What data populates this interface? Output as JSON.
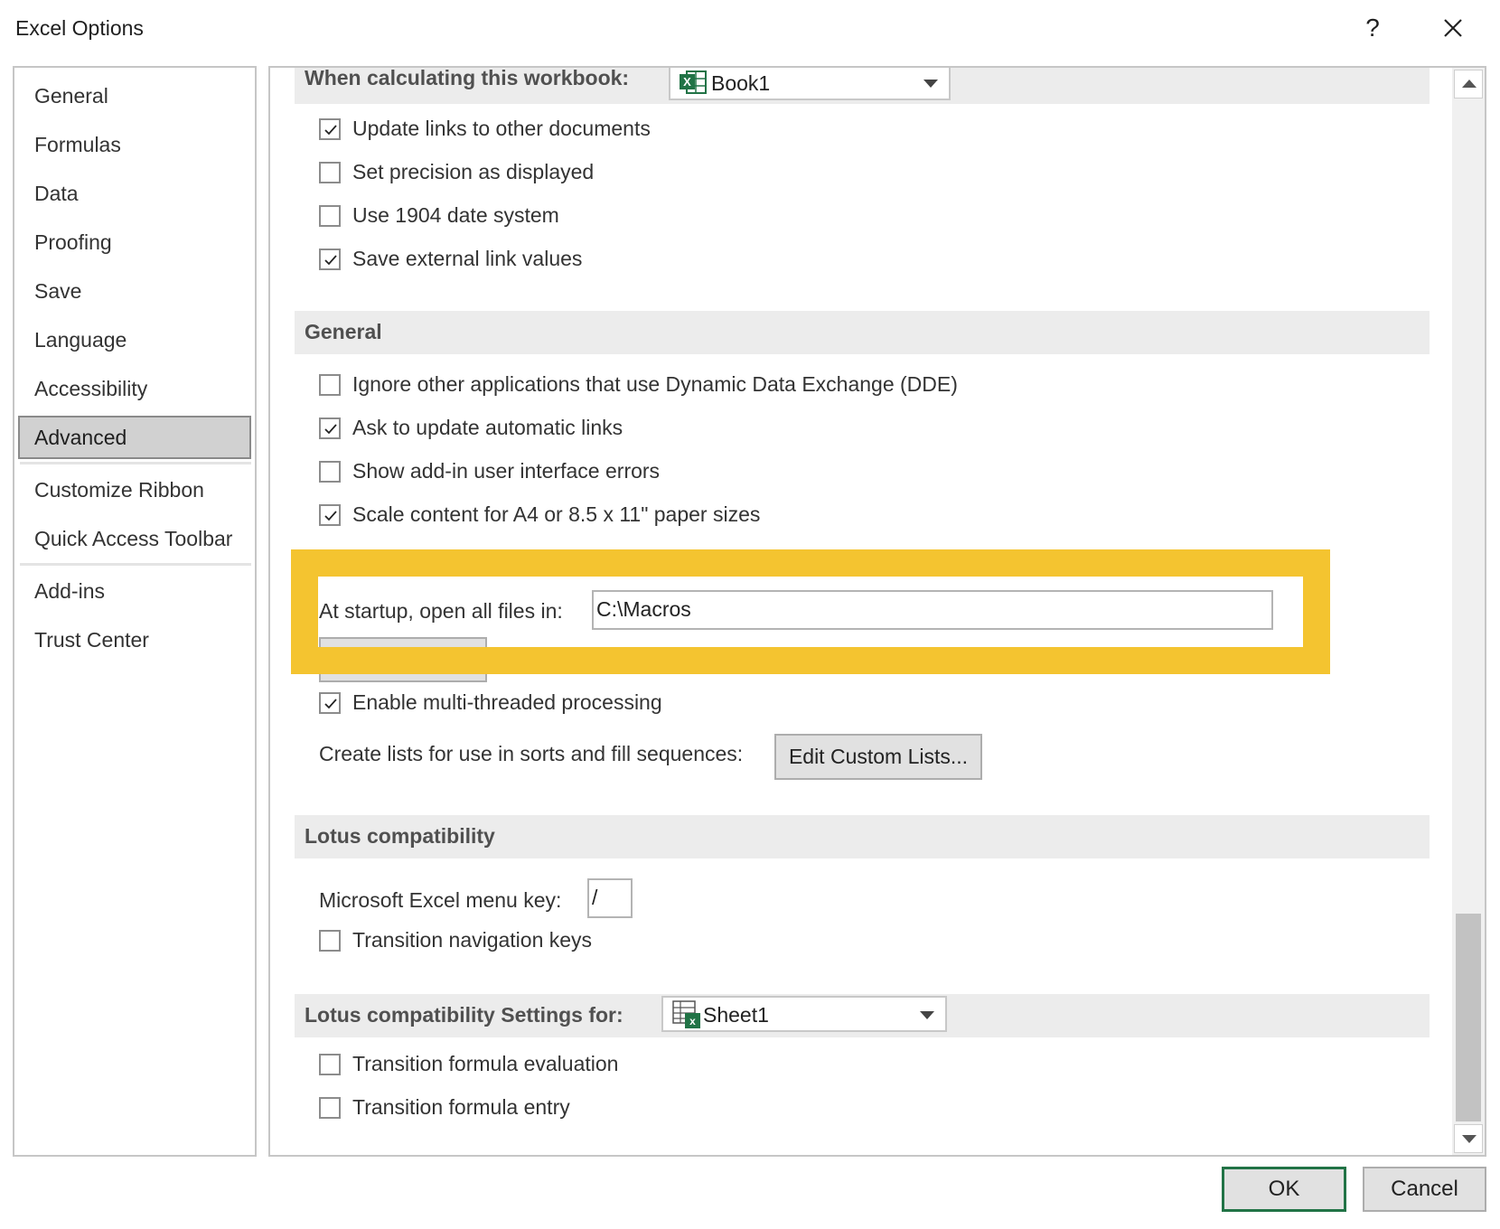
{
  "window": {
    "title": "Excel Options",
    "help": "?",
    "close": "✕"
  },
  "nav": {
    "items": [
      "General",
      "Formulas",
      "Data",
      "Proofing",
      "Save",
      "Language",
      "Accessibility",
      "Advanced",
      "Customize Ribbon",
      "Quick Access Toolbar",
      "Add-ins",
      "Trust Center"
    ],
    "selected": "Advanced"
  },
  "calc_section": {
    "title": "When calculating this workbook:",
    "workbook": "Book1",
    "options": [
      {
        "label": "Update links to other documents",
        "checked": true
      },
      {
        "label": "Set precision as displayed",
        "checked": false
      },
      {
        "label": "Use 1904 date system",
        "checked": false
      },
      {
        "label": "Save external link values",
        "checked": true
      }
    ]
  },
  "general_section": {
    "title": "General",
    "options": [
      {
        "label": "Ignore other applications that use Dynamic Data Exchange (DDE)",
        "checked": false
      },
      {
        "label": "Ask to update automatic links",
        "checked": true
      },
      {
        "label": "Show add-in user interface errors",
        "checked": false
      },
      {
        "label": "Scale content for A4 or 8.5 x 11\" paper sizes",
        "checked": true
      }
    ],
    "startup_label": "At startup, open all files in:",
    "startup_value": "C:\\Macros",
    "multithread": {
      "label": "Enable multi-threaded processing",
      "checked": true
    },
    "custom_lists_label": "Create lists for use in sorts and fill sequences:",
    "custom_lists_button": "Edit Custom Lists..."
  },
  "lotus_section": {
    "title": "Lotus compatibility",
    "menu_key_label": "Microsoft Excel menu key:",
    "menu_key_value": "/",
    "nav_keys": {
      "label": "Transition navigation keys",
      "checked": false
    }
  },
  "lotus_settings_section": {
    "title": "Lotus compatibility Settings for:",
    "sheet": "Sheet1",
    "options": [
      {
        "label": "Transition formula evaluation",
        "checked": false
      },
      {
        "label": "Transition formula entry",
        "checked": false
      }
    ]
  },
  "footer": {
    "ok": "OK",
    "cancel": "Cancel"
  },
  "colors": {
    "highlight": "#f4c430",
    "excel_green": "#217346",
    "selected_nav": "#d1d1d1"
  }
}
